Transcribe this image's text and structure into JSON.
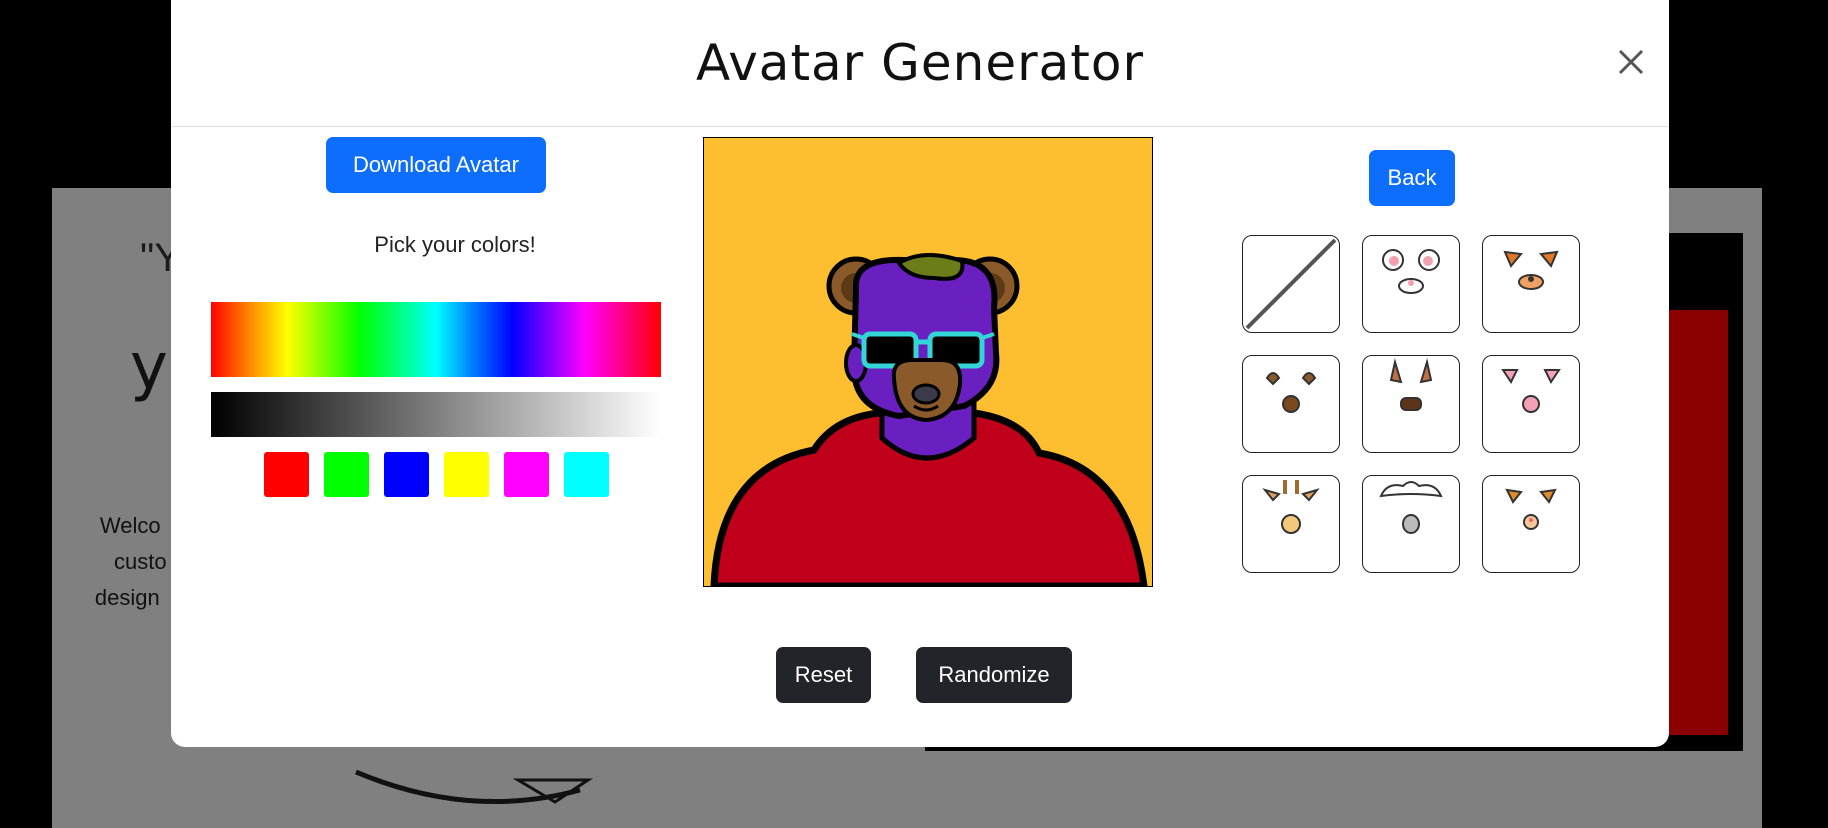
{
  "background": {
    "quote_fragment": "\"Y",
    "heading_fragment": "yo",
    "intro_lines": [
      "Welco",
      "custo",
      "design"
    ]
  },
  "modal": {
    "title": "Avatar Generator",
    "close_label": "×"
  },
  "left_panel": {
    "download_label": "Download Avatar",
    "pick_label": "Pick your colors!",
    "swatches": [
      "#ff0000",
      "#00ff00",
      "#0000ff",
      "#ffff00",
      "#ff00ff",
      "#00ffff"
    ]
  },
  "avatar": {
    "background_color": "#fdbf2f",
    "skin_color": "#6a1fc1",
    "hoodie_color": "#c0001a",
    "hair_color": "#6b7d18",
    "ears_color": "#8b5a2b",
    "glasses_frame_color": "#33d6d6"
  },
  "right_panel": {
    "back_label": "Back",
    "accessories": [
      {
        "name": "none",
        "icon": "none-slash-icon"
      },
      {
        "name": "bunny",
        "icon": "bunny-ears-icon"
      },
      {
        "name": "fox",
        "icon": "fox-ears-icon"
      },
      {
        "name": "bear",
        "icon": "bear-ears-icon"
      },
      {
        "name": "deer",
        "icon": "deer-ears-icon"
      },
      {
        "name": "pig",
        "icon": "pig-ears-icon"
      },
      {
        "name": "giraffe",
        "icon": "giraffe-ears-icon"
      },
      {
        "name": "sheep",
        "icon": "sheep-ears-icon"
      },
      {
        "name": "cat",
        "icon": "cat-ears-icon"
      }
    ]
  },
  "footer": {
    "reset_label": "Reset",
    "randomize_label": "Randomize"
  }
}
